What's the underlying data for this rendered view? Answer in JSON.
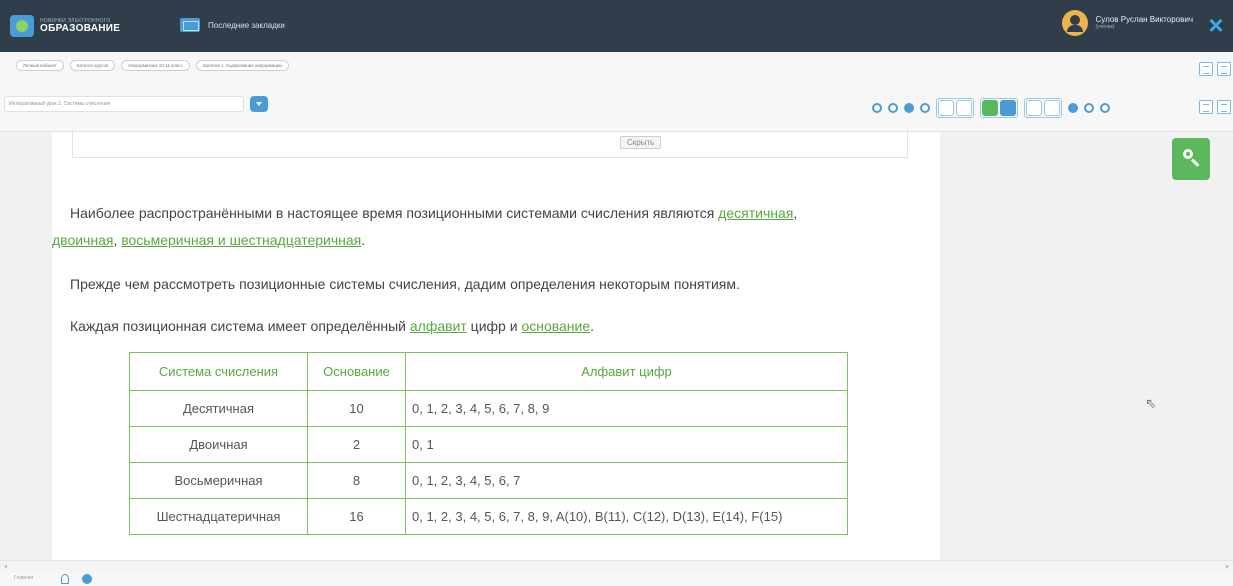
{
  "header": {
    "logo_small": "НОВИНКИ ЭЛЕКТРОННОГО",
    "logo_big": "ОБРАЗОВАНИЕ",
    "bookmarks_label": "Последние закладки",
    "user_name": "Сулов Руслан Викторович",
    "user_role": "(ученик)",
    "close_icon": "×"
  },
  "breadcrumbs": [
    "Личный кабинет",
    "Каталог курсов",
    "Информатика 10-11 класс",
    "Занятие 1. Кодирование информации"
  ],
  "lesson_select": {
    "value": "Интерактивный урок 2. Системы счисления"
  },
  "content": {
    "spoiler_button": "Скрыть",
    "p1_start": "Наиболее распространёнными в настоящее время позиционными системами счисления являются ",
    "p1_link1": "десятичная",
    "p1_sep1": ",",
    "p2_link2": "двоичная",
    "p2_sep2": ", ",
    "p2_link3": "восьмеричная и шестнадцатеричная",
    "p2_end": ".",
    "p3": "Прежде чем рассмотреть позиционные системы счисления, дадим определения некоторым понятиям.",
    "p4_start": "Каждая позиционная система имеет определённый ",
    "p4_link1": "алфавит",
    "p4_mid": " цифр и ",
    "p4_link2": "основание",
    "p4_end": "."
  },
  "table": {
    "headers": [
      "Система счисления",
      "Основание",
      "Алфавит цифр"
    ],
    "rows": [
      [
        "Десятичная",
        "10",
        "0, 1, 2, 3, 4, 5, 6, 7, 8, 9"
      ],
      [
        "Двоичная",
        "2",
        "0, 1"
      ],
      [
        "Восьмеричная",
        "8",
        "0, 1, 2, 3, 4, 5, 6, 7"
      ],
      [
        "Шестнадцатеричная",
        "16",
        "0, 1, 2, 3, 4, 5, 6, 7, 8, 9, A(10), B(11), C(12), D(13), E(14), F(15)"
      ]
    ]
  },
  "statusbar": {
    "label": "Главная"
  },
  "colors": {
    "topbar": "#2f3e4a",
    "accent_blue": "#4a9cd6",
    "accent_green": "#5cb85c",
    "link_green": "#57a93f"
  }
}
